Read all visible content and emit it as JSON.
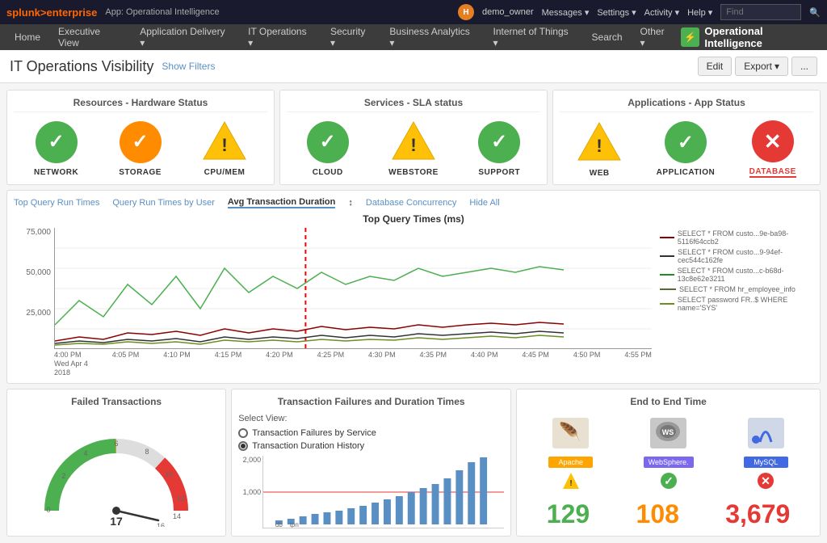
{
  "topbar": {
    "logo": "splunk>enterprise",
    "app": "App: Operational Intelligence",
    "user": "demo_owner",
    "user_initial": "H",
    "links": [
      "Messages",
      "Settings",
      "Activity",
      "Help"
    ],
    "find_placeholder": "Find"
  },
  "navbar": {
    "items": [
      "Home",
      "Executive View",
      "Application Delivery",
      "IT Operations",
      "Security",
      "Business Analytics",
      "Internet of Things",
      "Search",
      "Other"
    ],
    "logo_text": "Operational Intelligence"
  },
  "page": {
    "title": "IT Operations Visibility",
    "show_filters": "Show Filters",
    "edit_btn": "Edit",
    "export_btn": "Export",
    "more_btn": "..."
  },
  "resources_panel": {
    "title": "Resources - Hardware Status",
    "items": [
      {
        "label": "NETWORK",
        "status": "green_check"
      },
      {
        "label": "STORAGE",
        "status": "orange_check"
      },
      {
        "label": "CPU/MEM",
        "status": "yellow_warn"
      }
    ]
  },
  "services_panel": {
    "title": "Services - SLA status",
    "items": [
      {
        "label": "CLOUD",
        "status": "green_check"
      },
      {
        "label": "WEBSTORE",
        "status": "yellow_warn"
      },
      {
        "label": "SUPPORT",
        "status": "green_check"
      }
    ]
  },
  "applications_panel": {
    "title": "Applications - App Status",
    "items": [
      {
        "label": "WEB",
        "status": "yellow_warn"
      },
      {
        "label": "APPLICATION",
        "status": "green_check"
      },
      {
        "label": "DATABASE",
        "status": "red_x",
        "highlighted": true
      }
    ]
  },
  "chart": {
    "title": "Top Query Times (ms)",
    "tabs": [
      "Top Query Run Times",
      "Query Run Times by User",
      "Avg Transaction Duration",
      "Database Concurrency",
      "Hide All"
    ],
    "active_tab": "Avg Transaction Duration",
    "y_labels": [
      "75,000",
      "50,000",
      "25,000"
    ],
    "x_labels": [
      "4:00 PM\nWed Apr 4\n2018",
      "4:05 PM",
      "4:10 PM",
      "4:15 PM",
      "4:20 PM",
      "4:25 PM",
      "4:30 PM",
      "4:35 PM",
      "4:40 PM",
      "4:45 PM",
      "4:50 PM",
      "4:55 PM"
    ],
    "legend": [
      {
        "color": "#8B0000",
        "text": "SELECT * FROM custo...9e-ba98-5116f64ccb2"
      },
      {
        "color": "#333",
        "text": "SELECT * FROM custo...9-94ef-cec544c162fe"
      },
      {
        "color": "#228B22",
        "text": "SELECT * FROM custo...c-b68d-13c8e62e3211"
      },
      {
        "color": "#556B2F",
        "text": "SELECT * FROM hr_employee_info"
      },
      {
        "color": "#6B8E23",
        "text": "SELECT password FR..$ WHERE name='SYS'"
      }
    ]
  },
  "failed_tx": {
    "title": "Failed Transactions",
    "gauge_values": [
      "0",
      "2",
      "4",
      "6",
      "8",
      "10",
      "12",
      "14",
      "16"
    ],
    "gauge_max": 17,
    "current_value": "17"
  },
  "tx_failures": {
    "title": "Transaction Failures and Duration Times",
    "select_view": "Select View:",
    "options": [
      "Transaction Failures by Service",
      "Transaction Duration History"
    ],
    "selected": "Transaction Duration History",
    "y_labels": [
      "2,000",
      "1,000"
    ],
    "x_label": "db__tpn"
  },
  "e2e": {
    "title": "End to End Time",
    "icons": [
      {
        "name": "Apache",
        "badge": "Apache",
        "badge_color": "yellow"
      },
      {
        "name": "WebSphere",
        "badge": "WebSphere.",
        "badge_color": "purple"
      },
      {
        "name": "MySQL",
        "badge": "MySQL",
        "badge_color": "blue"
      }
    ],
    "numbers": [
      {
        "value": "129",
        "color": "green"
      },
      {
        "value": "108",
        "color": "orange"
      },
      {
        "value": "3,679",
        "color": "red"
      }
    ]
  }
}
